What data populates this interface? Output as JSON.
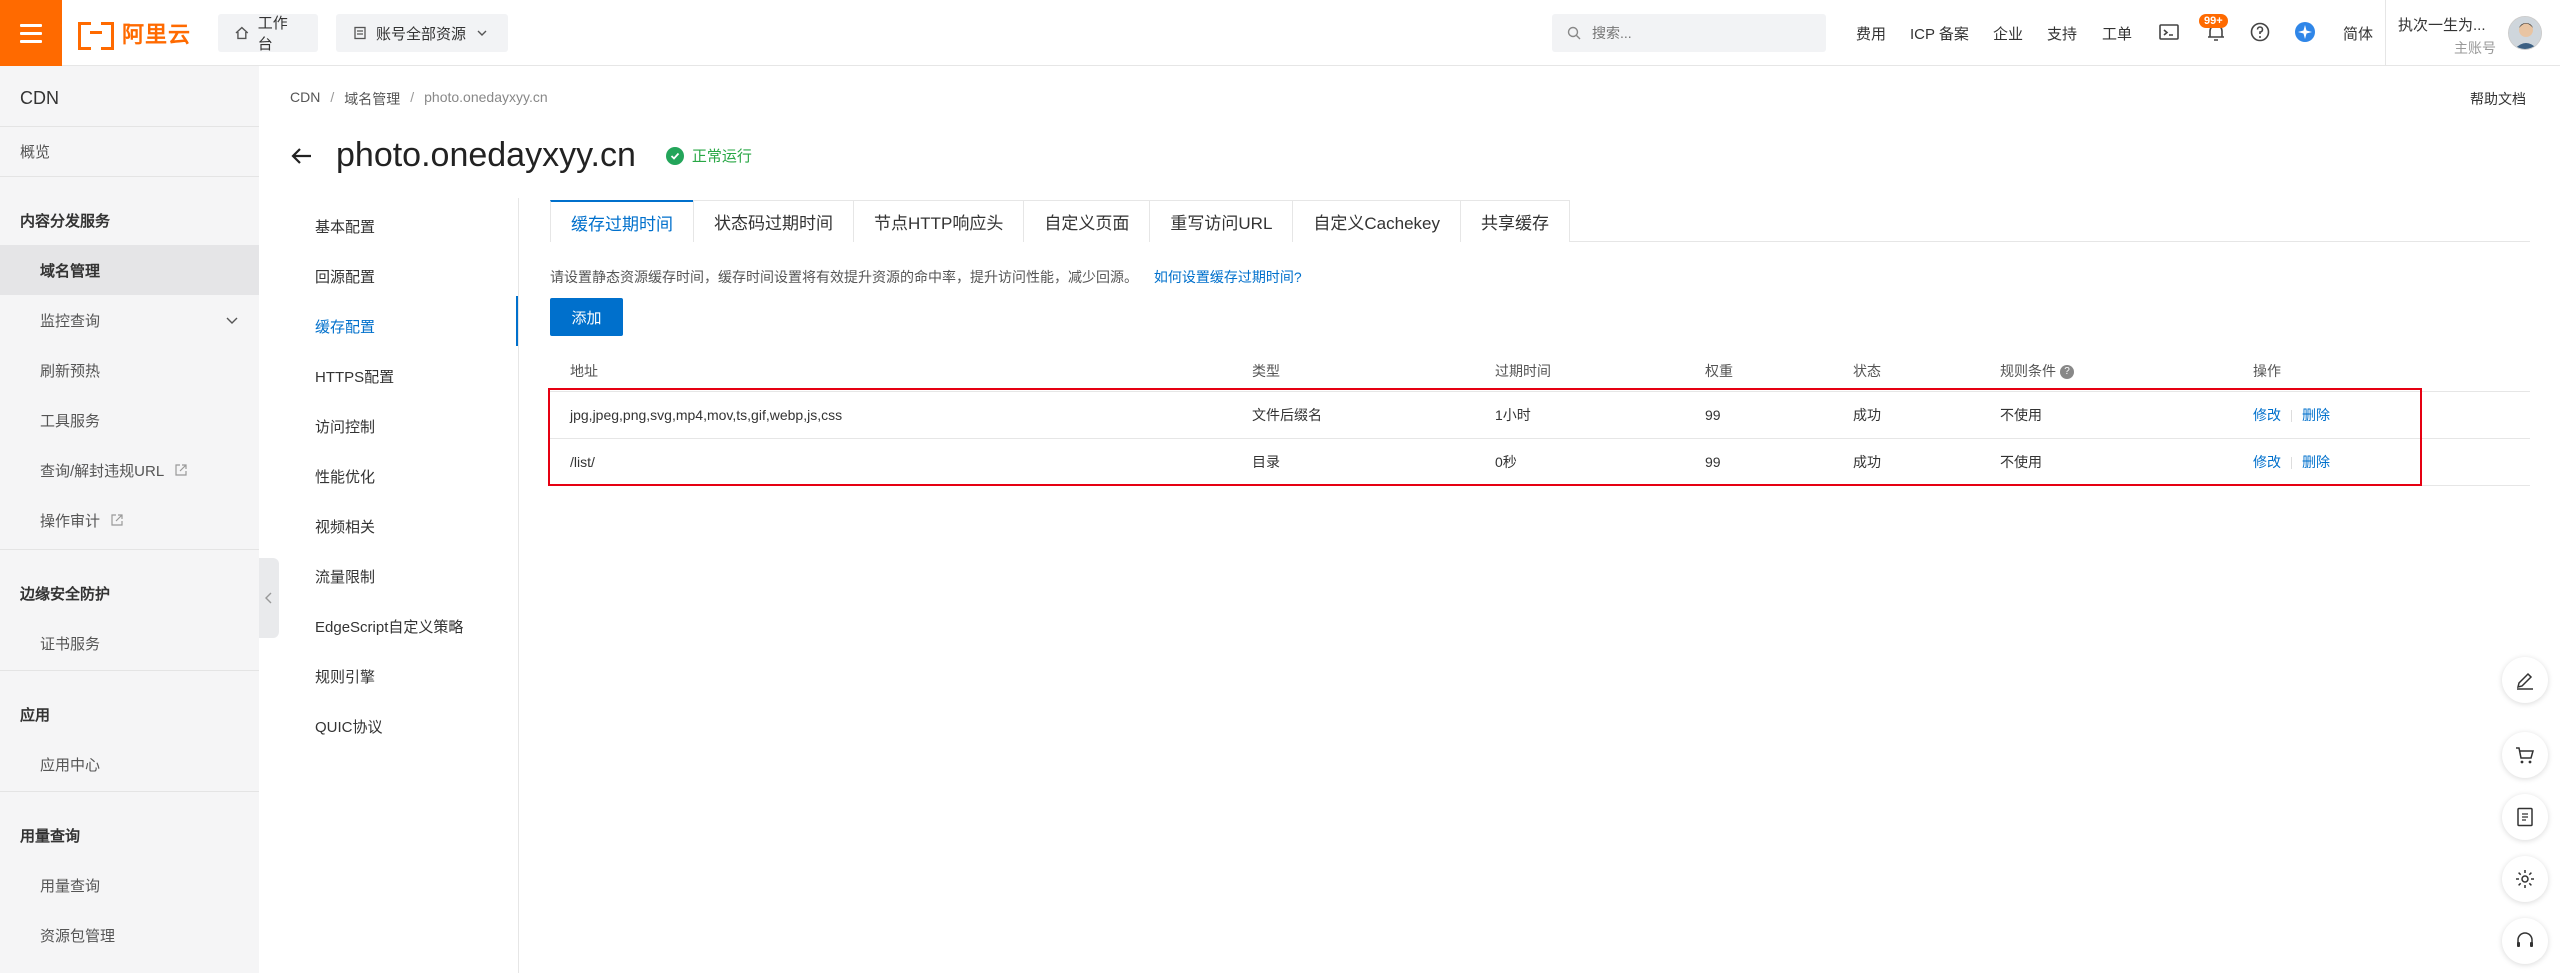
{
  "topbar": {
    "logo_text": "阿里云",
    "workbench": "工作台",
    "resources": "账号全部资源",
    "search_placeholder": "搜索...",
    "links": [
      "费用",
      "ICP 备案",
      "企业",
      "支持",
      "工单"
    ],
    "badge": "99+",
    "lang": "简体",
    "user_name": "执次一生为...",
    "user_sub": "主账号"
  },
  "leftnav": {
    "title": "CDN",
    "overview": "概览",
    "section_content": "内容分发服务",
    "domain_mgmt": "域名管理",
    "monitor": "监控查询",
    "refresh": "刷新预热",
    "tools": "工具服务",
    "query_url": "查询/解封违规URL",
    "audit": "操作审计",
    "section_security": "边缘安全防护",
    "cert": "证书服务",
    "section_app": "应用",
    "app_center": "应用中心",
    "section_usage": "用量查询",
    "usage_query": "用量查询",
    "package_mgmt": "资源包管理"
  },
  "breadcrumb": [
    "CDN",
    "/",
    "域名管理",
    "/",
    "photo.onedayxyy.cn"
  ],
  "help_doc": "帮助文档",
  "page": {
    "title": "photo.onedayxyy.cn",
    "status": "正常运行"
  },
  "subnav": [
    "基本配置",
    "回源配置",
    "缓存配置",
    "HTTPS配置",
    "访问控制",
    "性能优化",
    "视频相关",
    "流量限制",
    "EdgeScript自定义策略",
    "规则引擎",
    "QUIC协议"
  ],
  "tabs": [
    "缓存过期时间",
    "状态码过期时间",
    "节点HTTP响应头",
    "自定义页面",
    "重写访问URL",
    "自定义Cachekey",
    "共享缓存"
  ],
  "tip": {
    "text": "请设置静态资源缓存时间，缓存时间设置将有效提升资源的命中率，提升访问性能，减少回源。",
    "link": "如何设置缓存过期时间?"
  },
  "add_button": "添加",
  "table": {
    "headers": [
      "地址",
      "类型",
      "过期时间",
      "权重",
      "状态",
      "规则条件",
      "操作"
    ],
    "rows": [
      {
        "addr": "jpg,jpeg,png,svg,mp4,mov,ts,gif,webp,js,css",
        "type": "文件后缀名",
        "expire": "1小时",
        "weight": "99",
        "status": "成功",
        "cond": "不使用",
        "edit": "修改",
        "del": "删除"
      },
      {
        "addr": "/list/",
        "type": "目录",
        "expire": "0秒",
        "weight": "99",
        "status": "成功",
        "cond": "不使用",
        "edit": "修改",
        "del": "删除"
      }
    ]
  },
  "colors": {
    "accent": "#0070cc",
    "brand": "#ff6a00",
    "success": "#23a55a",
    "highlight": "#e60012"
  }
}
